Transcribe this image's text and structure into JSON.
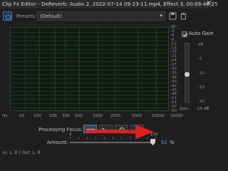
{
  "window": {
    "title": "Clip Fx Editor - DeReverb: Audio 2, 2022-07-14 09-23-11.mp4, Effect 3, 00:09:46:25",
    "close_glyph": "✕"
  },
  "toolbar": {
    "presets_label": "Presets:",
    "preset_value": "(Default)",
    "caret_glyph": "▾"
  },
  "graph": {
    "db_ticks": [
      "dB",
      "-3",
      "-6",
      "-9",
      "-12",
      "-15",
      "-18",
      "-21",
      "-24",
      "-27",
      "-30",
      "-33",
      "-36",
      "-39",
      "-42",
      "-45",
      "-48",
      "-51",
      "-54",
      "-57",
      "-60"
    ],
    "hz_ticks": [
      "Hz",
      "50",
      "100",
      "200",
      "300",
      "500",
      "1000",
      "2000",
      "5000",
      "10000",
      "20000"
    ]
  },
  "auto_gain": {
    "label": "Auto Gain",
    "checked": true,
    "scale": [
      "dB",
      "-5",
      "-10",
      "-15",
      "-20"
    ],
    "gain_label": "Gain",
    "gain_value": "-15 dB"
  },
  "processing_focus": {
    "label": "Processing Focus:",
    "buttons": [
      "flat-focus-icon",
      "low-focus-icon",
      "mid-focus-icon",
      "high-focus-icon"
    ],
    "active_index": 0
  },
  "amount": {
    "label": "Amount:",
    "scale_min": "0",
    "scale_max": "100",
    "value": "62",
    "unit": "%",
    "level_percent": 62
  },
  "io": {
    "label": "In: L, R | Out: L, R"
  },
  "colors": {
    "accent": "#4a90e2",
    "arrow": "#e02020",
    "graph_bg": "#0f1a10",
    "grid": "#1f3a22"
  }
}
